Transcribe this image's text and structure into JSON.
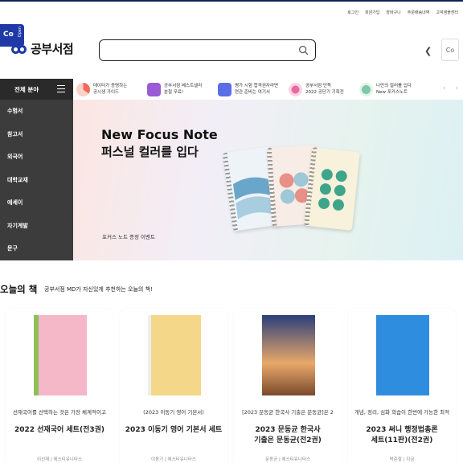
{
  "util_links": [
    "로그인",
    "회원가입",
    "장바구니",
    "주문배송내역",
    "고객샘플센터"
  ],
  "side_tab": {
    "logo": "Co",
    "label": "Open"
  },
  "logo": {
    "name": "공부서점",
    "icon": "infinity-logo-icon"
  },
  "search": {
    "value": "",
    "placeholder": "",
    "icon": "search-icon"
  },
  "header_buttons": {
    "history_icon": "chevron-left-icon",
    "recent_label": "Co"
  },
  "category": {
    "heading": "전체 분야",
    "menu_icon": "hamburger-icon",
    "items": [
      "수험서",
      "참고서",
      "외국어",
      "대학교재",
      "에세이",
      "자기계발",
      "문구"
    ]
  },
  "quick_links": [
    {
      "line1": "데이터가 증명하는",
      "line2": "공시생 가이드",
      "color": "#f06a5a"
    },
    {
      "line1": "공부서점 베스트셀러",
      "line2": "분철 무료!",
      "color": "#9b5bd6"
    },
    {
      "line1": "평가 시험 합격권자라면",
      "line2": "연관 준비는 여기서",
      "color": "#5a6ee8"
    },
    {
      "line1": "공부서점 단독",
      "line2": "2022 공단기 기획전",
      "color": "#e86aa0"
    },
    {
      "line1": "나만의 컬러를 입다",
      "line2": "New 포커스노트",
      "color": "#7ec9a6"
    }
  ],
  "quick_arrows": {
    "prev": "‹",
    "next": "›"
  },
  "banner": {
    "title_en": "New Focus Note",
    "title_ko": "퍼스널 컬러를 입다",
    "caption": "포커스 노트 증정 이벤트"
  },
  "md": {
    "title": "오늘의 책",
    "subtitle": "공부서점 MD가 자신있게 추천하는 오늘의 책!"
  },
  "books": [
    {
      "desc": "선재국어를 선택하는 것은 가장 체계적이고",
      "title_1": "2022 선재국어 세트(전3권)",
      "title_2": "",
      "author": "이선재 | 에스티유니타스",
      "cover": "#f4b8c8"
    },
    {
      "desc": "(2023 이동기 영어 기본서)",
      "title_1": "2023 이동기 영어 기본서 세트",
      "title_2": "",
      "author": "이동기 | 에스티유니타스",
      "cover": "#f5d78a"
    },
    {
      "desc": "[2023 문동균 한국사 기출은 문동균]은 2",
      "title_1": "2023 문동균 한국사",
      "title_2": "기출은 문동균(전2권)",
      "author": "문동균 | 에스티유니타스",
      "cover": "#e9a86a"
    },
    {
      "desc": "개념, 정리, 심화 학습이 한번에 가능한 최적",
      "title_1": "2023 써니 행정법총론",
      "title_2": "세트(11판)(전2권)",
      "author": "박준철 | 지금",
      "cover": "#2f8de0"
    }
  ]
}
